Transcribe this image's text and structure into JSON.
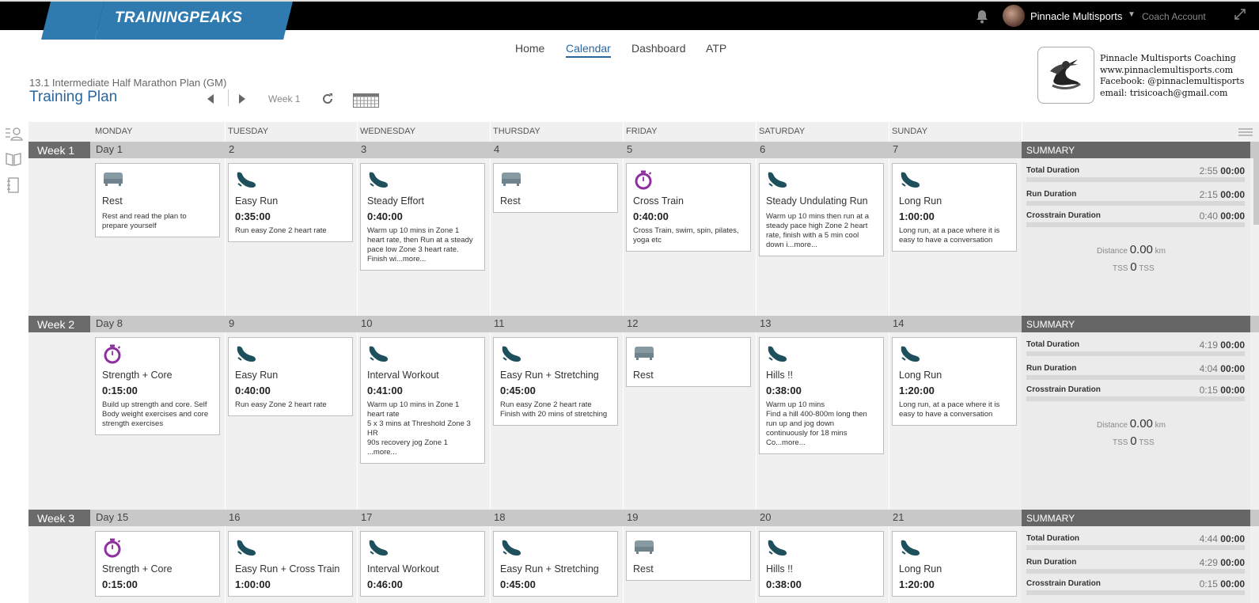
{
  "app": {
    "logo": "TRAININGPEAKS",
    "account_name": "Pinnacle Multisports",
    "coach_link": "Coach Account"
  },
  "nav": {
    "home": "Home",
    "calendar": "Calendar",
    "dashboard": "Dashboard",
    "atp": "ATP"
  },
  "plan": {
    "subtitle": "13.1 Intermediate Half Marathon Plan (GM)",
    "title": "Training Plan",
    "week_label": "Week 1"
  },
  "coach_card": {
    "line1": "Pinnacle Multisports Coaching",
    "line2": "www.pinnaclemultisports.com",
    "line3": "Facebook: @pinnaclemultisports",
    "line4": "email: trisicoach@gmail.com"
  },
  "days": [
    "MONDAY",
    "TUESDAY",
    "WEDNESDAY",
    "THURSDAY",
    "FRIDAY",
    "SATURDAY",
    "SUNDAY"
  ],
  "colors": {
    "run": "#1d4f5c",
    "strength": "#8e2ea0",
    "rest": "#8799a1",
    "accent": "#2a66a0"
  },
  "weeks": [
    {
      "label": "Week 1",
      "day_labels": [
        "Day 1",
        "2",
        "3",
        "4",
        "5",
        "6",
        "7"
      ],
      "summary": {
        "header": "SUMMARY",
        "total_label": "Total Duration",
        "total_planned": "2:55",
        "total_completed": "00:00",
        "run_label": "Run Duration",
        "run_planned": "2:15",
        "run_completed": "00:00",
        "cross_label": "Crosstrain Duration",
        "cross_planned": "0:40",
        "cross_completed": "00:00",
        "distance_label": "Distance",
        "distance_value": "0.00",
        "distance_unit": "km",
        "tss_label": "TSS",
        "tss_value": "0",
        "tss_unit": "TSS"
      },
      "workouts": [
        {
          "icon": "rest-icon",
          "title": "Rest",
          "duration": "",
          "desc": "Rest and read the plan to prepare yourself"
        },
        {
          "icon": "run-shoe-icon",
          "title": "Easy Run",
          "duration": "0:35:00",
          "desc": "Run easy Zone 2 heart rate"
        },
        {
          "icon": "run-shoe-icon",
          "title": "Steady Effort",
          "duration": "0:40:00",
          "desc": "Warm up 10 mins in Zone 1 heart rate, then Run at a steady pace low Zone 3 heart rate. Finish wi...more..."
        },
        {
          "icon": "rest-icon",
          "title": "Rest",
          "duration": "",
          "desc": ""
        },
        {
          "icon": "stopwatch-icon",
          "title": "Cross Train",
          "duration": "0:40:00",
          "desc": "Cross Train, swim, spin, pilates, yoga etc"
        },
        {
          "icon": "run-shoe-icon",
          "title": "Steady Undulating Run",
          "duration": "",
          "desc": "Warm up 10 mins then run at a steady pace high Zone 2 heart rate, finish with a 5 min cool down i...more..."
        },
        {
          "icon": "run-shoe-icon",
          "title": "Long Run",
          "duration": "1:00:00",
          "desc": "Long run, at a pace where it is easy to have a conversation"
        }
      ]
    },
    {
      "label": "Week 2",
      "day_labels": [
        "Day 8",
        "9",
        "10",
        "11",
        "12",
        "13",
        "14"
      ],
      "summary": {
        "header": "SUMMARY",
        "total_label": "Total Duration",
        "total_planned": "4:19",
        "total_completed": "00:00",
        "run_label": "Run Duration",
        "run_planned": "4:04",
        "run_completed": "00:00",
        "cross_label": "Crosstrain Duration",
        "cross_planned": "0:15",
        "cross_completed": "00:00",
        "distance_label": "Distance",
        "distance_value": "0.00",
        "distance_unit": "km",
        "tss_label": "TSS",
        "tss_value": "0",
        "tss_unit": "TSS"
      },
      "workouts": [
        {
          "icon": "stopwatch-icon",
          "title": "Strength + Core",
          "duration": "0:15:00",
          "desc": "Build up strength and core. Self Body weight exercises and core strength exercises"
        },
        {
          "icon": "run-shoe-icon",
          "title": "Easy Run",
          "duration": "0:40:00",
          "desc": "Run easy Zone 2 heart rate"
        },
        {
          "icon": "run-shoe-icon",
          "title": "Interval Workout",
          "duration": "0:41:00",
          "desc": "Warm up 10 mins in Zone 1 heart rate\n5 x 3 mins at Threshold Zone 3 HR\n90s recovery jog Zone 1\n...more..."
        },
        {
          "icon": "run-shoe-icon",
          "title": "Easy Run + Stretching",
          "duration": "0:45:00",
          "desc": "Run easy Zone 2 heart rate\nFinish with 20 mins of stretching"
        },
        {
          "icon": "rest-icon",
          "title": "Rest",
          "duration": "",
          "desc": ""
        },
        {
          "icon": "run-shoe-icon",
          "title": "Hills !!",
          "duration": "0:38:00",
          "desc": "Warm up 10 mins\nFind a hill 400-800m long then run up and jog down continuously for 18 mins\nCo...more..."
        },
        {
          "icon": "run-shoe-icon",
          "title": "Long Run",
          "duration": "1:20:00",
          "desc": "Long run, at a pace where it is easy to have a conversation"
        }
      ]
    },
    {
      "label": "Week 3",
      "day_labels": [
        "Day 15",
        "16",
        "17",
        "18",
        "19",
        "20",
        "21"
      ],
      "summary": {
        "header": "SUMMARY",
        "total_label": "Total Duration",
        "total_planned": "4:44",
        "total_completed": "00:00",
        "run_label": "Run Duration",
        "run_planned": "4:29",
        "run_completed": "00:00",
        "cross_label": "Crosstrain Duration",
        "cross_planned": "0:15",
        "cross_completed": "00:00"
      },
      "workouts": [
        {
          "icon": "stopwatch-icon",
          "title": "Strength + Core",
          "duration": "0:15:00",
          "desc": ""
        },
        {
          "icon": "run-shoe-icon",
          "title": "Easy Run + Cross Train",
          "duration": "1:00:00",
          "desc": ""
        },
        {
          "icon": "run-shoe-icon",
          "title": "Interval Workout",
          "duration": "0:46:00",
          "desc": ""
        },
        {
          "icon": "run-shoe-icon",
          "title": "Easy Run + Stretching",
          "duration": "0:45:00",
          "desc": ""
        },
        {
          "icon": "rest-icon",
          "title": "Rest",
          "duration": "",
          "desc": ""
        },
        {
          "icon": "run-shoe-icon",
          "title": "Hills !!",
          "duration": "0:38:00",
          "desc": ""
        },
        {
          "icon": "run-shoe-icon",
          "title": "Long Run",
          "duration": "1:20:00",
          "desc": ""
        }
      ]
    }
  ]
}
